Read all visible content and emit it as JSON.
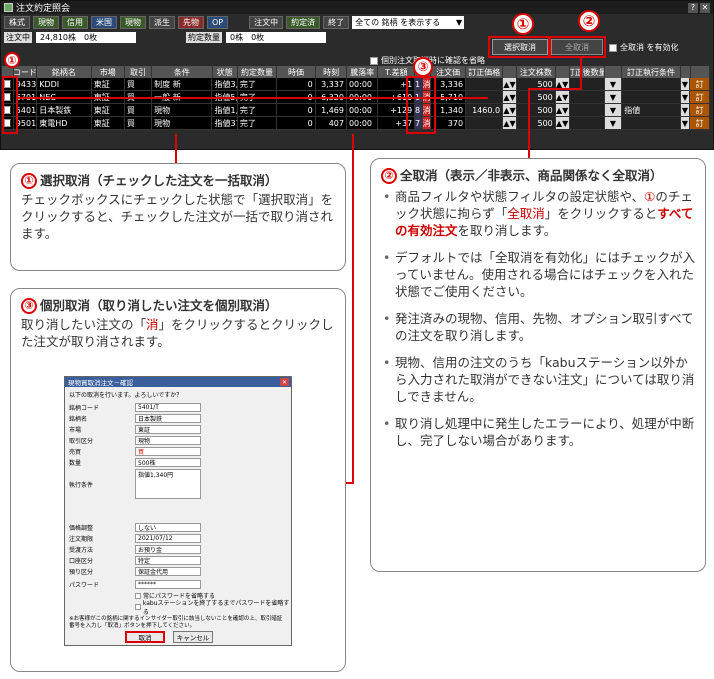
{
  "app": {
    "title": "注文約定照会"
  },
  "filters": {
    "items": [
      {
        "label": "株式",
        "cls": "gy"
      },
      {
        "label": "現物",
        "cls": "g"
      },
      {
        "label": "信用",
        "cls": "g"
      },
      {
        "label": "米国",
        "cls": "b"
      },
      {
        "label": "現物",
        "cls": "g"
      },
      {
        "label": "派生",
        "cls": "gy"
      },
      {
        "label": "先物",
        "cls": "r"
      },
      {
        "label": "OP",
        "cls": "b"
      },
      {
        "label": "注文中",
        "cls": "gy"
      },
      {
        "label": "約定済",
        "cls": "g"
      },
      {
        "label": "終了",
        "cls": "gy"
      }
    ],
    "select": "全ての 銘柄 を表示する"
  },
  "summary": {
    "label1": "注文中",
    "value1": "24,810株　0枚",
    "label2": "約定数量",
    "value2": "0株　0枚"
  },
  "buttons": {
    "select_cancel": "選択取消",
    "all_cancel": "全取消",
    "all_cancel_enable": "全取消 を有効化",
    "cancel_confirm": "個別注文取消時に確認を省略"
  },
  "table": {
    "headers": [
      "",
      "コード",
      "銘柄名",
      "市場",
      "取引",
      "条件",
      "状態",
      "約定数量",
      "時価",
      "時刻",
      "騰落率",
      "T.差額",
      "",
      "",
      "注文価",
      "訂正価格",
      "",
      "注文株数",
      "",
      "訂正後数量",
      "",
      "訂正執行条件",
      "",
      ""
    ],
    "rows": [
      {
        "code": "9433",
        "name": "KDDI",
        "market": "東証",
        "side": "買",
        "type": "制度 新",
        "cond": "指値3,336円",
        "state": "完了",
        "qty": "0",
        "price": "3,337",
        "time": "00:00",
        "chg": "+1",
        "diff": "1",
        "cancel": "消",
        "order": "3,336",
        "mod": "",
        "shares": "500",
        "modqty": "",
        "modcond": "",
        "act": "訂"
      },
      {
        "code": "6701",
        "name": "NEC",
        "market": "東証",
        "side": "買",
        "type": "一般 新",
        "cond": "指値5,710円",
        "state": "完了",
        "qty": "0",
        "price": "6,320",
        "time": "00:00",
        "chg": "+610",
        "diff": "61",
        "cancel": "消",
        "order": "5,710",
        "mod": "",
        "shares": "500",
        "modqty": "",
        "modcond": "",
        "act": "訂"
      },
      {
        "code": "5401",
        "name": "日本製鉄",
        "market": "東証",
        "side": "買",
        "type": "現物",
        "cond": "指値1,340円",
        "state": "完了",
        "qty": "0",
        "price": "1,469",
        "time": "00:00",
        "chg": "+129",
        "diff": "258",
        "cancel": "消",
        "order": "1,340",
        "mod": "1460.0",
        "shares": "500",
        "modqty": "",
        "modcond": "指値",
        "act": "訂"
      },
      {
        "code": "9501",
        "name": "東電HD",
        "market": "東証",
        "side": "買",
        "type": "現物",
        "cond": "指値370円",
        "state": "完了",
        "qty": "0",
        "price": "407",
        "time": "00:00",
        "chg": "+37",
        "diff": "37",
        "cancel": "消",
        "order": "370",
        "mod": "",
        "shares": "500",
        "modqty": "",
        "modcond": "",
        "act": "訂"
      }
    ]
  },
  "callout1": {
    "num": "①",
    "title": "選択取消（チェックした注文を一括取消）",
    "body": "チェックボックスにチェックした状態で「選択取消」をクリックすると、チェックした注文が一括で取り消されます。"
  },
  "callout2": {
    "num": "②",
    "title": "全取消（表示／非表示、商品関係なく全取消）",
    "b1a": "商品フィルタや状態フィルタの設定状態や、",
    "b1num": "①",
    "b1b": "のチェック状態に拘らず「",
    "b1red": "全取消",
    "b1c": "」をクリックすると",
    "b1bold": "すべての有効注文",
    "b1d": "を取り消します。",
    "b2": "デフォルトでは「全取消を有効化」にはチェックが入っていません。使用される場合にはチェックを入れた状態でご使用ください。",
    "b3": "発注済みの現物、信用、先物、オプション取引すべての注文を取り消します。",
    "b4": "現物、信用の注文のうち「kabuステーション以外から入力された取消ができない注文」については取り消しできません。",
    "b5": "取り消し処理中に発生したエラーにより、処理が中断し、完了しない場合があります。"
  },
  "callout3": {
    "num": "③",
    "title": "個別取消（取り消したい注文を個別取消）",
    "body_a": "取り消したい注文の「",
    "body_red": "消",
    "body_b": "」をクリックするとクリックした注文が取り消されます。"
  },
  "dialog": {
    "title": "現物買取消注文－確認",
    "question": "以下の取消を行います。よろしいですか？",
    "rows": [
      {
        "l": "銘柄コード",
        "v": "5401/T"
      },
      {
        "l": "銘柄名",
        "v": "日本製鉄"
      },
      {
        "l": "市場",
        "v": "東証"
      },
      {
        "l": "取引区分",
        "v": "現物"
      },
      {
        "l": "売買",
        "v": "買"
      },
      {
        "l": "数量",
        "v": "500株"
      },
      {
        "l": "執行条件",
        "v": "指値1,340円"
      }
    ],
    "rows2": [
      {
        "l": "価格調整",
        "v": "しない"
      },
      {
        "l": "注文期限",
        "v": "2021/07/12"
      },
      {
        "l": "受渡方法",
        "v": "お預り金"
      },
      {
        "l": "口座区分",
        "v": "特定"
      },
      {
        "l": "預り区分",
        "v": "保証金代用"
      }
    ],
    "pw_label": "パスワード",
    "pw_value": "******",
    "pw_check1": "常にパスワードを省略する",
    "pw_check2": "kabuステーションを終了するまでパスワードを省略する",
    "note": "※お客様がこの銘柄に関するインサイダー取引に該当しないことを確認の上、取引暗証番号を入力し「取消」ボタンを押下してください。",
    "ok": "取消",
    "cancel": "キャンセル"
  },
  "circles": {
    "c1": "①",
    "c2": "②",
    "c3": "③"
  }
}
